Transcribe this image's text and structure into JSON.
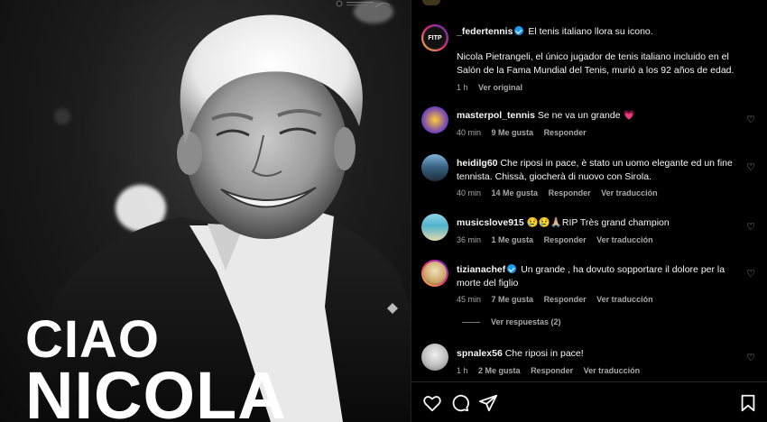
{
  "post": {
    "headline_line1": "CIAO",
    "headline_line2": "NICOLA"
  },
  "caption": {
    "username": "_federtennis",
    "verified": true,
    "avatar_text": "FITP",
    "title": "El tenis italiano llora su icono.",
    "body": "Nicola Pietrangeli, el único jugador de tenis italiano incluido en el Salón de la Fama Mundial del Tenis, murió a los 92 años de edad.",
    "time": "1 h",
    "translate": "Ver original"
  },
  "comments": [
    {
      "username": "masterpol_tennis",
      "verified": false,
      "text": "Se ne va un grande 💗",
      "time": "40 min",
      "likes": "9 Me gusta",
      "reply": "Responder",
      "translate": ""
    },
    {
      "username": "heidilg60",
      "verified": false,
      "text": "Che riposi in pace, è stato un uomo elegante ed un fine tennista. Chissà, giocherà di nuovo con Sirola.",
      "time": "40 min",
      "likes": "14 Me gusta",
      "reply": "Responder",
      "translate": "Ver traducción"
    },
    {
      "username": "musicslove915",
      "verified": false,
      "text": "😢😢🙏🏼RIP Très grand champion",
      "time": "36 min",
      "likes": "1 Me gusta",
      "reply": "Responder",
      "translate": "Ver traducción"
    },
    {
      "username": "tizianachef",
      "verified": true,
      "text": "Un grande , ha dovuto sopportare il dolore per la morte del figlio",
      "time": "45 min",
      "likes": "7 Me gusta",
      "reply": "Responder",
      "translate": "Ver traducción"
    },
    {
      "username": "spnalex56",
      "verified": false,
      "text": "Che riposi in pace!",
      "time": "1 h",
      "likes": "2 Me gusta",
      "reply": "Responder",
      "translate": "Ver traducción"
    }
  ],
  "view_replies": "Ver respuestas (2)",
  "icons": {
    "like": "heart-icon",
    "comment": "comment-icon",
    "share": "send-icon",
    "save": "bookmark-icon"
  },
  "colors": {
    "background": "#000000",
    "text": "#f5f5f5",
    "muted": "#a8a8a8",
    "verified": "#1d9bf0",
    "heart_emoji": "#ee2a7b"
  }
}
